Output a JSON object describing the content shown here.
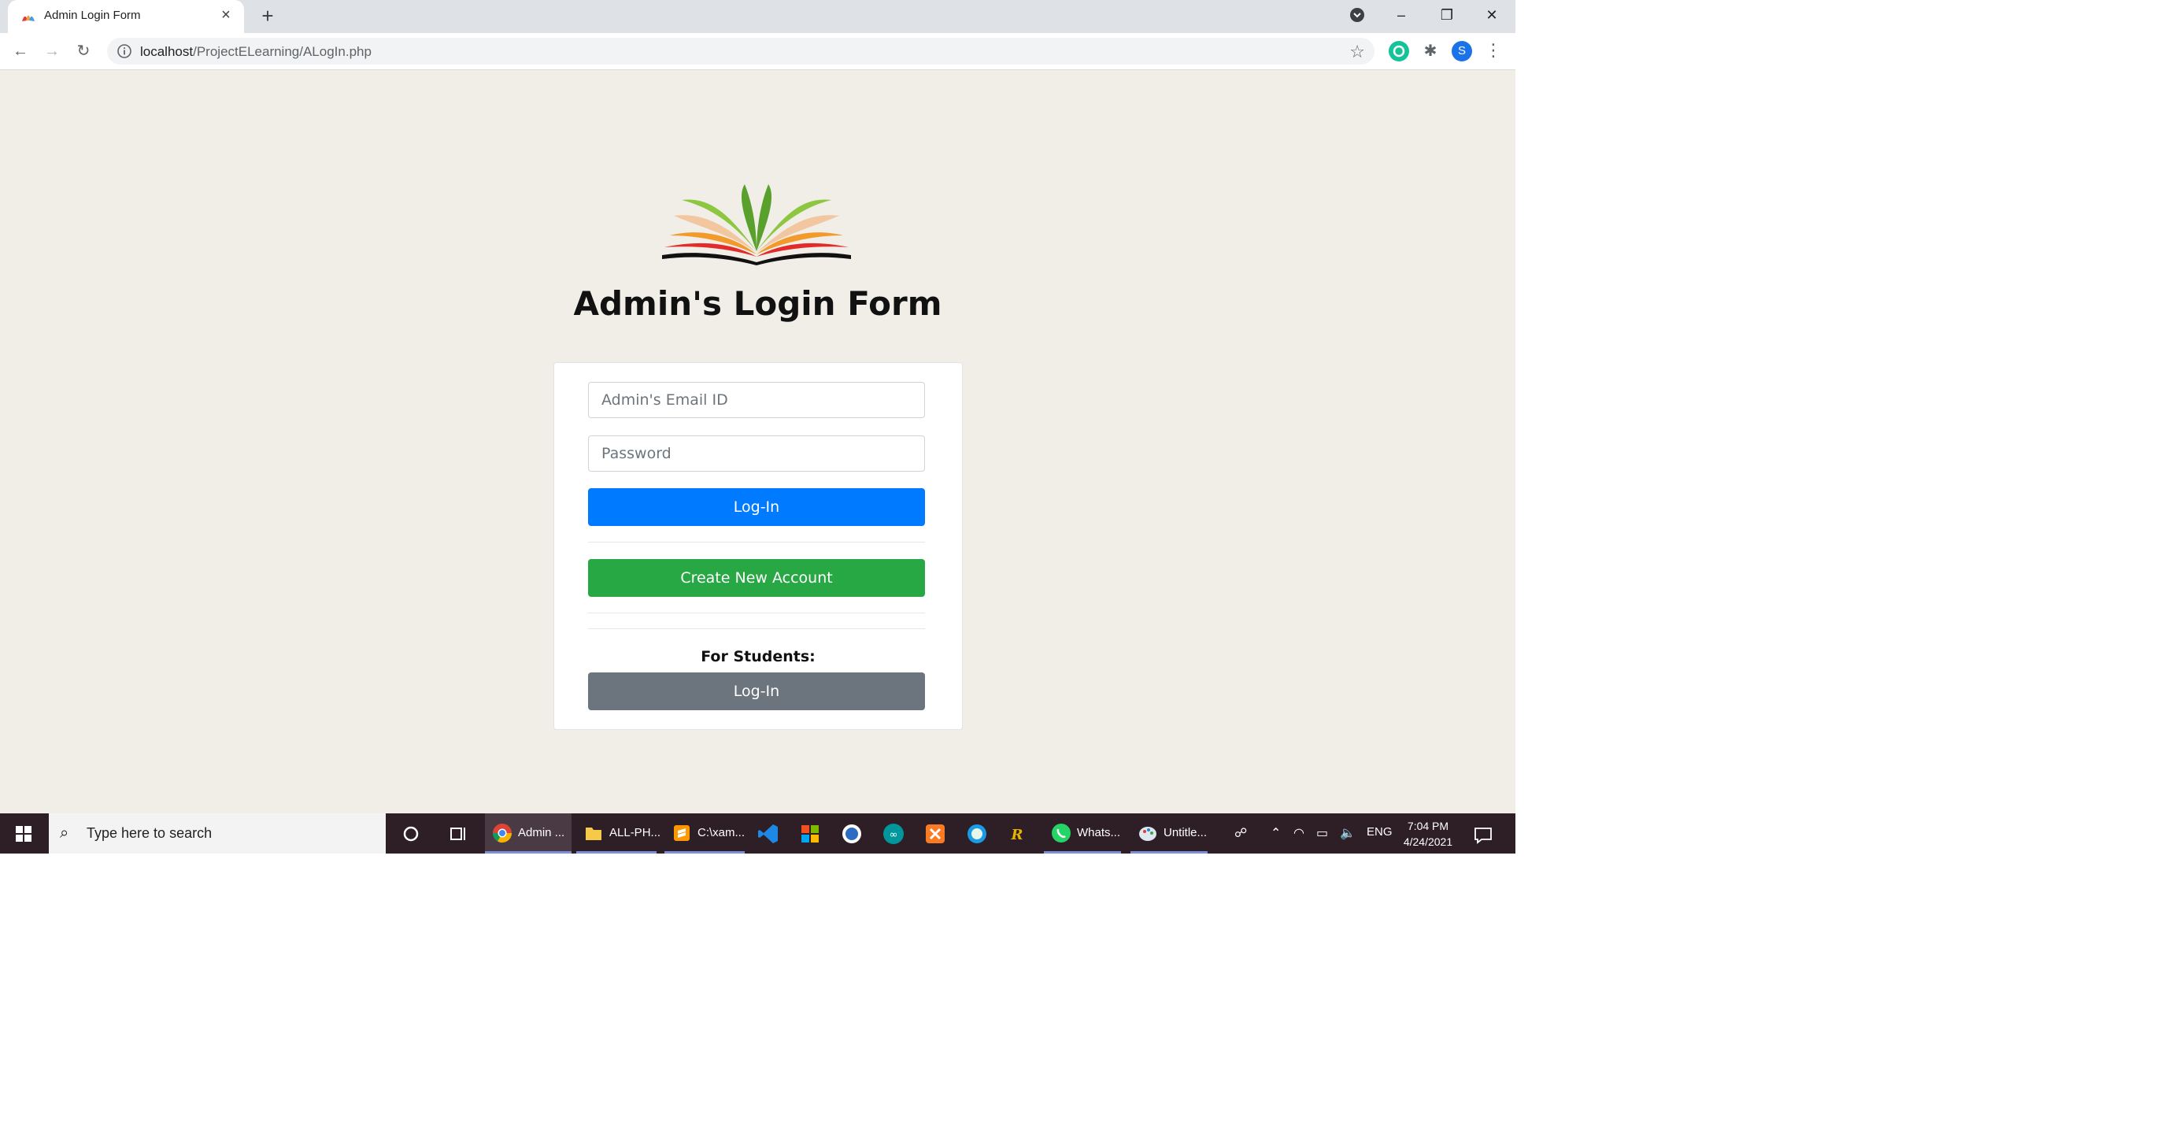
{
  "browser": {
    "tab_title": "Admin Login Form",
    "url_host": "localhost",
    "url_path": "/ProjectELearning/ALogIn.php",
    "profile_initial": "S"
  },
  "page": {
    "title": "Admin's Login Form",
    "email_placeholder": "Admin's Email ID",
    "password_placeholder": "Password",
    "login_label": "Log-In",
    "create_account_label": "Create New Account",
    "students_heading": "For Students:",
    "student_login_label": "Log-In"
  },
  "colors": {
    "login_button": "#007bff",
    "create_button": "#28a745",
    "student_button": "#6c757d",
    "page_background": "#f0eee7"
  },
  "taskbar": {
    "search_placeholder": "Type here to search",
    "apps": [
      {
        "label": "Admin ...",
        "icon": "chrome-icon"
      },
      {
        "label": "ALL-PH...",
        "icon": "file-explorer-icon"
      },
      {
        "label": "C:\\xam...",
        "icon": "sublime-text-icon"
      },
      {
        "label": "Whats...",
        "icon": "whatsapp-icon"
      },
      {
        "label": "Untitle...",
        "icon": "paint-icon"
      }
    ],
    "language": "ENG",
    "time": "7:04 PM",
    "date": "4/24/2021"
  }
}
